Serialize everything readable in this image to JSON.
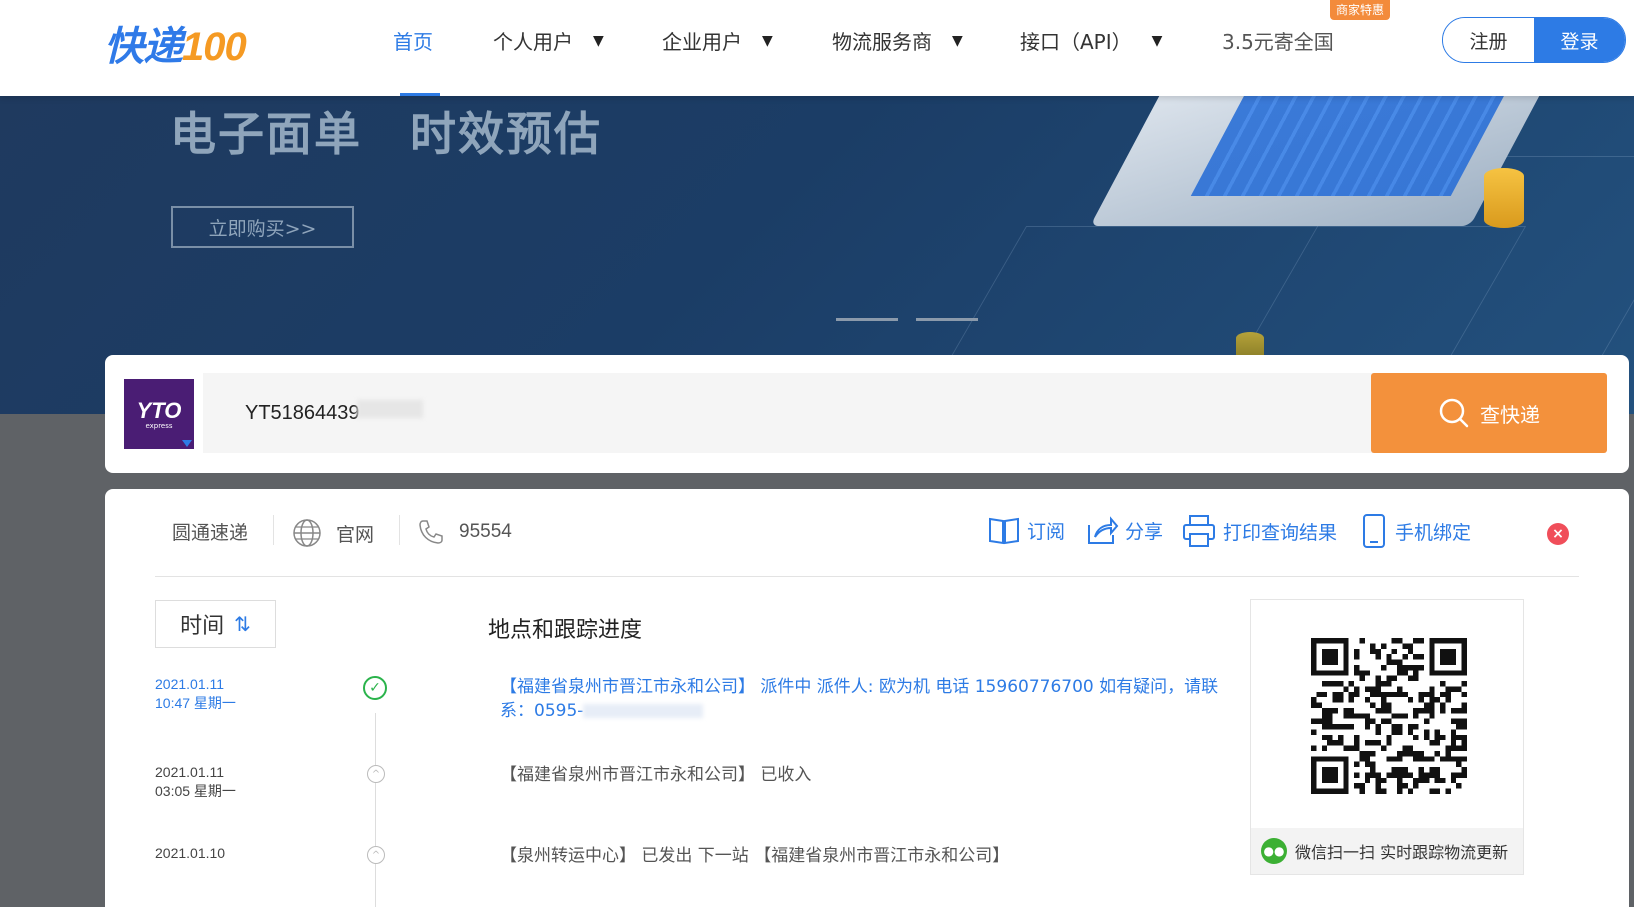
{
  "header": {
    "logo_part1": "快递",
    "logo_part2": "100",
    "nav": [
      {
        "label": "首页",
        "active": true
      },
      {
        "label": "个人用户",
        "caret": "▼"
      },
      {
        "label": "企业用户",
        "caret": "▼"
      },
      {
        "label": "物流服务商",
        "caret": "▼"
      },
      {
        "label": "接口（API）",
        "caret": "▼"
      },
      {
        "label": "3.5元寄全国"
      }
    ],
    "promo_badge": "商家特惠",
    "register_label": "注册",
    "login_label": "登录"
  },
  "banner": {
    "title_1": "电子面单",
    "title_2": "时效预估",
    "buy_button": "立即购买>>"
  },
  "search": {
    "carrier_logo_text": "YTO",
    "carrier_logo_sub": "express",
    "tracking_number": "YT51864439",
    "button_label": "查快递",
    "icon": "search-icon"
  },
  "carrier": {
    "name": "圆通速递",
    "website_label": "官网",
    "phone": "95554"
  },
  "actions": {
    "subscribe": "订阅",
    "share": "分享",
    "print": "打印查询结果",
    "bind_phone": "手机绑定",
    "close": "×"
  },
  "table": {
    "time_label": "时间",
    "sort_arrow": "⇅",
    "progress_label": "地点和跟踪进度"
  },
  "events": [
    {
      "date": "2021.01.11",
      "time": "10:47 星期一",
      "text": "【福建省泉州市晋江市永和公司】 派件中 派件人: 欧为机 电话 15960776700 如有疑问，请联系：0595-",
      "status": "done"
    },
    {
      "date": "2021.01.11",
      "time": "03:05 星期一",
      "text": "【福建省泉州市晋江市永和公司】 已收入",
      "status": "pending"
    },
    {
      "date": "2021.01.10",
      "time": "",
      "text": "【泉州转运中心】 已发出 下一站 【福建省泉州市晋江市永和公司】",
      "status": "pending"
    }
  ],
  "qr": {
    "caption": "微信扫一扫 实时跟踪物流更新",
    "wechat_icon": "wechat-icon"
  },
  "colors": {
    "brand_blue": "#2d7be5",
    "brand_orange": "#f3913c",
    "yto_purple": "#4a1d74",
    "done_green": "#2ab34b"
  }
}
